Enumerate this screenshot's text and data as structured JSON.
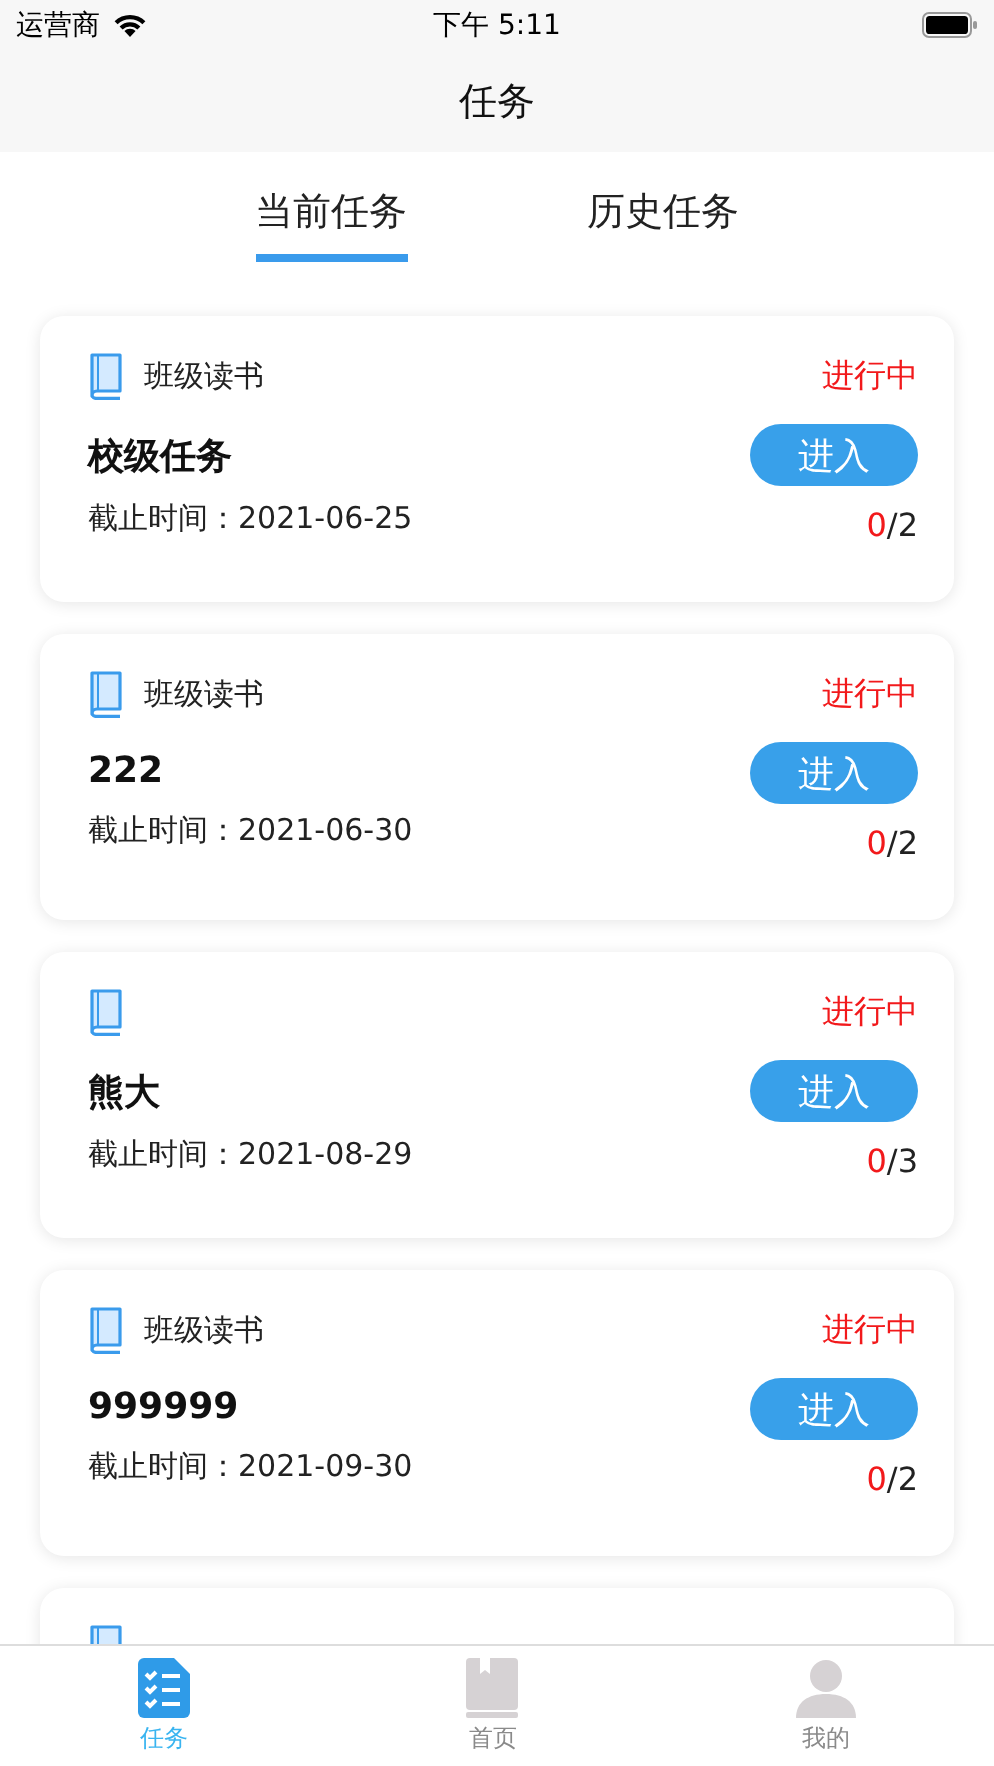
{
  "status_bar": {
    "carrier": "运营商",
    "time": "下午 5:11"
  },
  "nav": {
    "title": "任务"
  },
  "tabs": [
    {
      "label": "当前任务",
      "selected": true
    },
    {
      "label": "历史任务",
      "selected": false
    }
  ],
  "tasks": [
    {
      "category": "班级读书",
      "status": "进行中",
      "title": "校级任务",
      "deadline": "截止时间：2021-06-25",
      "button": "进入",
      "done": "0",
      "rest": "/2"
    },
    {
      "category": "班级读书",
      "status": "进行中",
      "title": "222",
      "deadline": "截止时间：2021-06-30",
      "button": "进入",
      "done": "0",
      "rest": "/2"
    },
    {
      "status": "进行中",
      "title": "熊大",
      "deadline": "截止时间：2021-08-29",
      "button": "进入",
      "done": "0",
      "rest": "/3"
    },
    {
      "category": "班级读书",
      "status": "进行中",
      "title": "999999",
      "deadline": "截止时间：2021-09-30",
      "button": "进入",
      "done": "0",
      "rest": "/2"
    }
  ],
  "more_cards_below": true,
  "tab_bar": [
    {
      "label": "任务",
      "kind": "tasks",
      "selected": true
    },
    {
      "label": "首页",
      "kind": "home",
      "selected": false
    },
    {
      "label": "我的",
      "kind": "profile",
      "selected": false
    }
  ]
}
